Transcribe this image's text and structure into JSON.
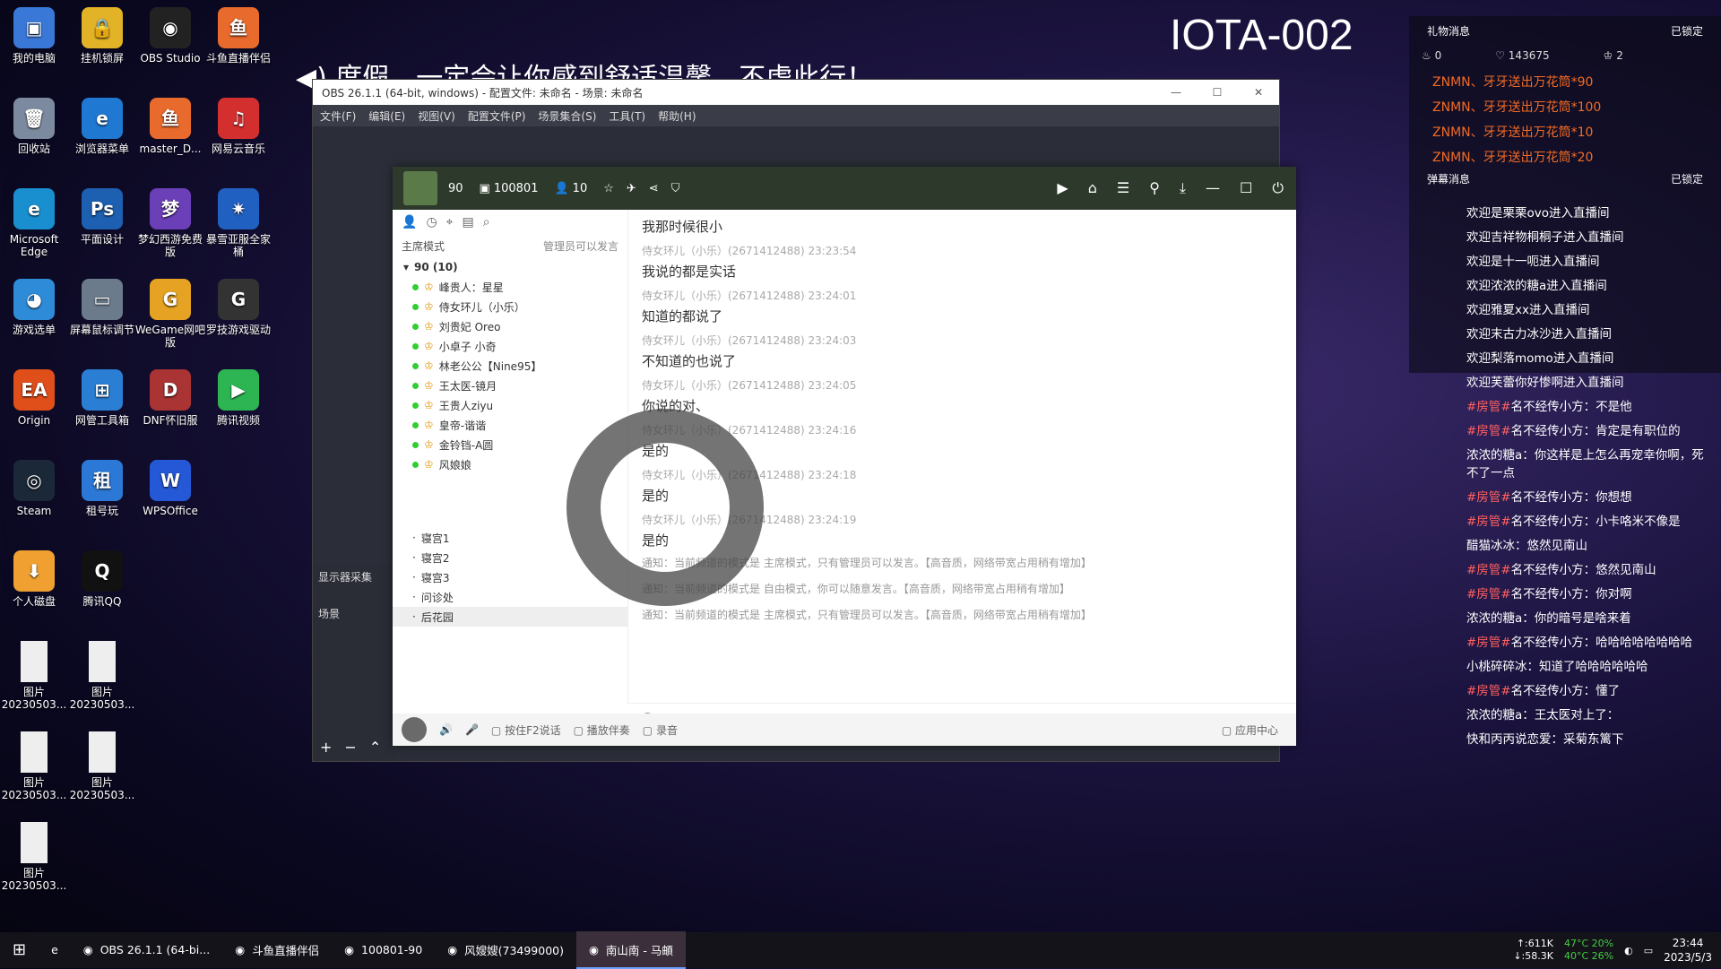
{
  "desktop": {
    "icons": [
      {
        "label": "我的电脑",
        "icon": "computer-icon",
        "color": "#3a78d8",
        "glyph": "▣"
      },
      {
        "label": "挂机锁屏",
        "icon": "lock-icon",
        "color": "#e2b227",
        "glyph": "🔒"
      },
      {
        "label": "OBS Studio",
        "icon": "obs-icon",
        "color": "#222",
        "glyph": "◉"
      },
      {
        "label": "回收站",
        "icon": "recycle-bin-icon",
        "color": "#7c8aa0",
        "glyph": "🗑"
      },
      {
        "label": "浏览器菜单",
        "icon": "ie-icon",
        "color": "#1f78d1",
        "glyph": "e"
      },
      {
        "label": "master_D...",
        "icon": "douyu-master-icon",
        "color": "#e86a2c",
        "glyph": "鱼"
      },
      {
        "label": "斗鱼直播伴侣",
        "icon": "douyu-icon",
        "color": "#e86a2c",
        "glyph": "鱼"
      },
      {
        "label": "Microsoft Edge",
        "icon": "edge-icon",
        "color": "#1a8fcf",
        "glyph": "e"
      },
      {
        "label": "平面设计",
        "icon": "photoshop-icon",
        "color": "#1d5fb0",
        "glyph": "Ps"
      },
      {
        "label": "梦幻西游免费版",
        "icon": "game-icon",
        "color": "#6b3fb8",
        "glyph": "梦"
      },
      {
        "label": "网易云音乐",
        "icon": "netease-music-icon",
        "color": "#d42f2f",
        "glyph": "♫"
      },
      {
        "label": "游戏选单",
        "icon": "game-menu-icon",
        "color": "#2e8bd8",
        "glyph": "◕"
      },
      {
        "label": "屏幕鼠标调节",
        "icon": "monitor-icon",
        "color": "#6b7b8c",
        "glyph": "▭"
      },
      {
        "label": "WeGame网吧版",
        "icon": "wegame-icon",
        "color": "#e6a323",
        "glyph": "G"
      },
      {
        "label": "暴雪亚服全家桶",
        "icon": "battlenet-icon",
        "color": "#2060c0",
        "glyph": "✷"
      },
      {
        "label": "Origin",
        "icon": "ea-icon",
        "color": "#e04e1a",
        "glyph": "EA"
      },
      {
        "label": "网管工具箱",
        "icon": "windows-icon",
        "color": "#2a7fd4",
        "glyph": "⊞"
      },
      {
        "label": "DNF怀旧服",
        "icon": "dnf-icon",
        "color": "#a33",
        "glyph": "D"
      },
      {
        "label": "罗技游戏驱动",
        "icon": "logitech-icon",
        "color": "#333",
        "glyph": "G"
      },
      {
        "label": "Steam",
        "icon": "steam-icon",
        "color": "#1b2838",
        "glyph": "◎"
      },
      {
        "label": "租号玩",
        "icon": "rent-icon",
        "color": "#2b78d6",
        "glyph": "租"
      },
      {
        "label": "WPSOffice",
        "icon": "wps-icon",
        "color": "#2458d6",
        "glyph": "W"
      },
      {
        "label": "腾讯视频",
        "icon": "tencent-video-icon",
        "color": "#2cb552",
        "glyph": "▶"
      },
      {
        "label": "个人磁盘",
        "icon": "disk-icon",
        "color": "#f0a030",
        "glyph": "⬇"
      },
      {
        "label": "腾讯QQ",
        "icon": "qq-icon",
        "color": "#111",
        "glyph": "Q"
      },
      {
        "label": "图片 20230503...",
        "icon": "file-icon",
        "color": "#eeeeee",
        "glyph": ""
      },
      {
        "label": "图片 20230503...",
        "icon": "file-icon",
        "color": "#eeeeee",
        "glyph": ""
      },
      {
        "label": "图片 20230503...",
        "icon": "file-icon",
        "color": "#eeeeee",
        "glyph": ""
      },
      {
        "label": "图片 20230503...",
        "icon": "file-icon",
        "color": "#eeeeee",
        "glyph": ""
      },
      {
        "label": "图片 20230503...",
        "icon": "file-icon",
        "color": "#eeeeee",
        "glyph": ""
      }
    ]
  },
  "overlay": {
    "room_title": "IOTA-002",
    "banner": "◀) 度假，一定会让你感到舒适温馨，不虚此行！"
  },
  "obs": {
    "title": "OBS 26.1.1 (64-bit, windows) - 配置文件: 未命名 - 场景: 未命名",
    "menu": [
      "文件(F)",
      "编辑(E)",
      "视图(V)",
      "配置文件(P)",
      "场景集合(S)",
      "工具(T)",
      "帮助(H)"
    ],
    "left_label": "显示器采集",
    "scene_label": "场景"
  },
  "yy": {
    "top": {
      "level": "90",
      "channel_id": "100801",
      "online": "10"
    },
    "mode_label": "主席模式",
    "mode_hint": "管理员可以发言",
    "group": "90 (10)",
    "members": [
      {
        "name": "峰贵人：星星"
      },
      {
        "name": "侍女环儿（小乐）"
      },
      {
        "name": "刘贵妃 Oreo"
      },
      {
        "name": "小卓子 小奇"
      },
      {
        "name": "林老公公【Nine95】"
      },
      {
        "name": "王太医-镜月"
      },
      {
        "name": "王贵人ziyu"
      },
      {
        "name": "皇帝-谐谐"
      },
      {
        "name": "金铃铛-A圆"
      },
      {
        "name": "风娘娘"
      }
    ],
    "rooms": [
      "寝宫1",
      "寝宫2",
      "寝宫3",
      "问诊处",
      "后花园"
    ],
    "messages": [
      {
        "meta": "",
        "text": "我那时候很小"
      },
      {
        "meta": "侍女环儿（小乐）(2671412488)  23:23:54",
        "text": "我说的都是实话"
      },
      {
        "meta": "侍女环儿（小乐）(2671412488)  23:24:01",
        "text": "知道的都说了"
      },
      {
        "meta": "侍女环儿（小乐）(2671412488)  23:24:03",
        "text": "不知道的也说了"
      },
      {
        "meta": "侍女环儿（小乐）(2671412488)  23:24:05",
        "text": "你说的对、"
      },
      {
        "meta": "侍女环儿（小乐）(2671412488)  23:24:16",
        "text": "是的"
      },
      {
        "meta": "侍女环儿（小乐）(2671412488)  23:24:18",
        "text": "是的"
      },
      {
        "meta": "侍女环儿（小乐）(2671412488)  23:24:19",
        "text": "是的"
      }
    ],
    "notices": [
      "通知：当前频道的模式是 主席模式，只有管理员可以发言。【高音质，网络带宽占用稍有增加】",
      "通知：当前频道的模式是 自由模式，你可以随意发言。【高音质，网络带宽占用稍有增加】",
      "通知：当前频道的模式是 主席模式，只有管理员可以发言。【高音质，网络带宽占用稍有增加】"
    ],
    "bottom": [
      "按住F2说话",
      "播放伴奏",
      "录音",
      "应用中心"
    ]
  },
  "gift_panel": {
    "title": "礼物消息",
    "locked": "已锁定",
    "stats": [
      "0",
      "143675",
      "2"
    ],
    "items": [
      "ZNMN、牙牙送出万花筒*90",
      "ZNMN、牙牙送出万花筒*100",
      "ZNMN、牙牙送出万花筒*10",
      "ZNMN、牙牙送出万花筒*20"
    ]
  },
  "danmu_panel": {
    "title": "弹幕消息",
    "locked": "已锁定"
  },
  "chat": [
    {
      "tag": "",
      "name": "欢迎是栗栗ovo进入直播间"
    },
    {
      "tag": "",
      "name": "欢迎吉祥物桐桐子进入直播间"
    },
    {
      "tag": "",
      "name": "欢迎是十一呃进入直播间"
    },
    {
      "tag": "",
      "name": "欢迎浓浓的糖a进入直播间"
    },
    {
      "tag": "",
      "name": "欢迎雅夏xx进入直播间"
    },
    {
      "tag": "",
      "name": "欢迎末古力冰沙进入直播间"
    },
    {
      "tag": "",
      "name": "欢迎梨落momo进入直播间"
    },
    {
      "tag": "",
      "name": "欢迎芙蕾你好惨啊进入直播间"
    },
    {
      "tag": "#房管#",
      "name": "名不经传小方：不是他"
    },
    {
      "tag": "#房管#",
      "name": "名不经传小方：肯定是有职位的"
    },
    {
      "tag": "",
      "name": "浓浓的糖a：你这样是上怎么再宠幸你啊，死不了一点"
    },
    {
      "tag": "#房管#",
      "name": "名不经传小方：你想想"
    },
    {
      "tag": "#房管#",
      "name": "名不经传小方：小卡咯米不像是"
    },
    {
      "tag": "",
      "name": "醋猫冰冰：悠然见南山"
    },
    {
      "tag": "#房管#",
      "name": "名不经传小方：悠然见南山"
    },
    {
      "tag": "#房管#",
      "name": "名不经传小方：你对啊"
    },
    {
      "tag": "",
      "name": "浓浓的糖a：你的暗号是啥来着"
    },
    {
      "tag": "#房管#",
      "name": "名不经传小方：哈哈哈哈哈哈哈哈"
    },
    {
      "tag": "",
      "name": "小桃碎碎冰：知道了哈哈哈哈哈哈"
    },
    {
      "tag": "#房管#",
      "name": "名不经传小方：懂了"
    },
    {
      "tag": "",
      "name": "浓浓的糖a：王太医对上了："
    },
    {
      "tag": "",
      "name": "快和丙丙说恋爱：采菊东篱下"
    }
  ],
  "taskbar": {
    "items": [
      {
        "label": "OBS 26.1.1 (64-bi...",
        "icon": "obs-icon",
        "active": false
      },
      {
        "label": "斗鱼直播伴侣",
        "icon": "douyu-icon",
        "active": false
      },
      {
        "label": "100801-90",
        "icon": "yy-icon",
        "active": false
      },
      {
        "label": "风嫂嫂(73499000)",
        "icon": "avatar-icon",
        "active": false
      },
      {
        "label": "南山南 - 马頔",
        "icon": "netease-music-icon",
        "active": true
      }
    ],
    "net_up": "↑:611K",
    "net_down": "↓:58.3K",
    "cpu1": "47°C 20%",
    "cpu2": "40°C 26%",
    "time": "23:44",
    "date": "2023/5/3"
  }
}
